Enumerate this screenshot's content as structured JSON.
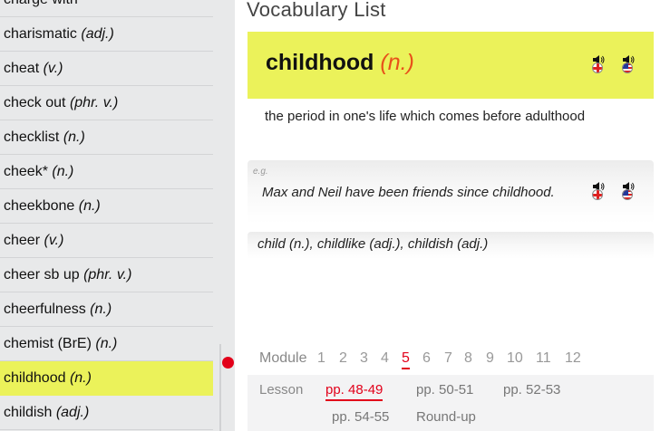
{
  "word_list": {
    "items": [
      {
        "word": "charge with",
        "pos": ""
      },
      {
        "word": "charismatic",
        "pos": "(adj.)"
      },
      {
        "word": "cheat",
        "pos": "(v.)"
      },
      {
        "word": "check out",
        "pos": "(phr. v.)"
      },
      {
        "word": "checklist",
        "pos": "(n.)"
      },
      {
        "word": "cheek*",
        "pos": "(n.)"
      },
      {
        "word": "cheekbone",
        "pos": "(n.)"
      },
      {
        "word": "cheer",
        "pos": "(v.)"
      },
      {
        "word": "cheer sb up",
        "pos": "(phr. v.)"
      },
      {
        "word": "cheerfulness",
        "pos": "(n.)"
      },
      {
        "word": "chemist (BrE)",
        "pos": "(n.)"
      },
      {
        "word": "childhood",
        "pos": "(n.)"
      },
      {
        "word": "childish",
        "pos": "(adj.)"
      }
    ],
    "selected_index": 11
  },
  "header": {
    "title": "Vocabulary List"
  },
  "entry": {
    "headword": "childhood",
    "pos": "(n.)",
    "definition": "the period in one's life which comes before adulthood",
    "example_label": "e.g.",
    "example": "Max and Neil have been friends since childhood.",
    "word_family": "child (n.), childlike (adj.), childish (adj.)",
    "audio_icons": [
      "speaker-uk-flag-icon",
      "speaker-us-flag-icon"
    ]
  },
  "navigation": {
    "module_label": "Module",
    "modules": [
      "1",
      "2",
      "3",
      "4",
      "5",
      "6",
      "7",
      "8",
      "9",
      "10",
      "11",
      "12"
    ],
    "active_module": "5",
    "lesson_label": "Lesson",
    "lessons": [
      "pp. 48-49",
      "pp. 50-51",
      "pp. 52-53",
      "pp. 54-55",
      "Round-up"
    ],
    "active_lesson": "pp. 48-49"
  },
  "colors": {
    "highlight": "#ebf25a",
    "accent_red": "#e2001a",
    "pos_orange": "#e8511a",
    "sidebar_bg": "#e8e9ea"
  }
}
